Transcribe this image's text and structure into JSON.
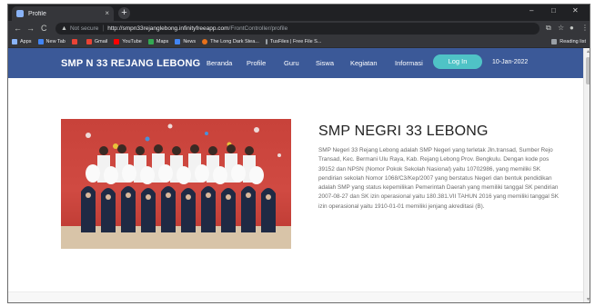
{
  "browser": {
    "tab_title": "Profile",
    "tab_close": "×",
    "new_tab": "+",
    "window_controls": [
      "–",
      "□",
      "✕"
    ],
    "nav_buttons": [
      "←",
      "→",
      "C"
    ],
    "security_label": "Not secure",
    "url_host": "http://smpn33rejanglebong.infinityfreeapp.com",
    "url_path": "/FrontController/profile",
    "right_icons": [
      "⧉",
      "☆",
      "●",
      "⋮"
    ]
  },
  "bookmarks": [
    {
      "label": "Apps",
      "color": "#8ab4f8",
      "icon": "apps-grid-icon"
    },
    {
      "label": "New Tab",
      "color": "#4285f4",
      "icon": "newtab-icon"
    },
    {
      "label": "",
      "color": "#ea4335",
      "icon": "youtube-icon"
    },
    {
      "label": "Gmail",
      "color": "#ea4335",
      "icon": "gmail-icon"
    },
    {
      "label": "YouTube",
      "color": "#ff0000",
      "icon": "youtube-icon"
    },
    {
      "label": "Maps",
      "color": "#34a853",
      "icon": "maps-icon"
    },
    {
      "label": "News",
      "color": "#4285f4",
      "icon": "news-icon"
    },
    {
      "label": "The Long Dark Stea...",
      "color": "#e8711a",
      "icon": "steam-icon"
    },
    {
      "label": "TusFiles | Free File S...",
      "color": "#9aa0a6",
      "icon": "tusfiles-icon"
    }
  ],
  "reading_list": "Reading list",
  "site": {
    "brand": "SMP N 33 REJANG LEBONG",
    "menu": [
      "Beranda",
      "Profile",
      "Guru",
      "Siswa",
      "Kegiatan",
      "Informasi"
    ],
    "login": "Log In",
    "date": "10-Jan-2022",
    "colors": {
      "nav": "#3b5998",
      "login": "#4fc3c6"
    }
  },
  "about": {
    "title": "SMP NEGRI 33 LEBONG",
    "text": "SMP Negeri 33 Rejang Lebong adalah SMP Negeri yang terletak Jln.transad, Sumber Rejo Transad, Kec. Bermani Ulu Raya, Kab. Rejang Lebong Prov. Bengkulu. Dengan kode pos 39152 dan NPSN (Nomor Pokok Sekolah Nasional) yaitu 10702986, yang memiliki SK pendirian sekolah Nomor 1068/C3/Kep/2007 yang berstatus Negeri dan bentuk pendidikan adalah SMP yang status kepemilikan Pemerintah Daerah yang memiliki tanggal SK pendirian 2007-08-27 dan SK izin operasional yaitu 180.381.VII TAHUN 2016 yang memiliki tanggal SK izin operasional yaitu 1910-01-01 memiliki jenjang akreditasi (B)."
  }
}
